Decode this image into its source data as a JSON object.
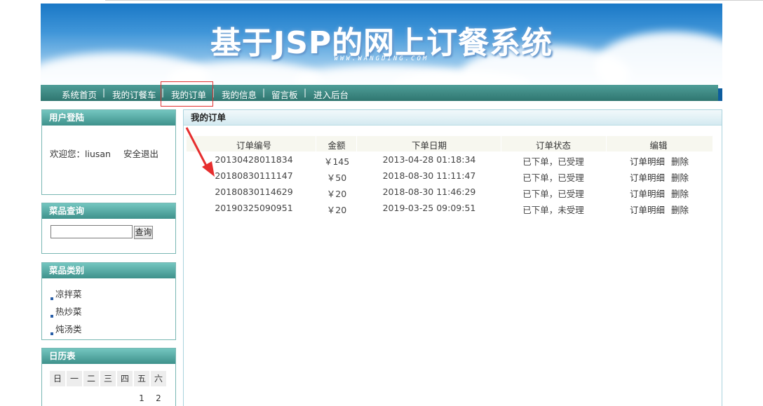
{
  "banner": {
    "title": "基于JSP的网上订餐系统",
    "subtitle": "WWW.WANGDING.COM"
  },
  "nav": {
    "items": [
      "系统首页",
      "我的订餐车",
      "我的订单",
      "我的信息",
      "留言板",
      "进入后台"
    ],
    "separator": "|",
    "active_index": 2
  },
  "login": {
    "title": "用户登陆",
    "welcome": "欢迎您：liusan",
    "logout": "安全退出"
  },
  "search": {
    "title": "菜品查询",
    "value": "",
    "button": "查询"
  },
  "categories": {
    "title": "菜品类别",
    "items": [
      "凉拌菜",
      "热炒菜",
      "炖汤类"
    ]
  },
  "calendar": {
    "title": "日历表",
    "weekdays": [
      "日",
      "一",
      "二",
      "三",
      "四",
      "五",
      "六"
    ],
    "first_row": [
      "",
      "",
      "",
      "",
      "",
      "1",
      "2"
    ]
  },
  "orders": {
    "title": "我的订单",
    "columns": [
      "订单编号",
      "金额",
      "下单日期",
      "订单状态",
      "编辑"
    ],
    "rows": [
      {
        "id": "20130428011834",
        "amount": "￥145",
        "date": "2013-04-28 01:18:34",
        "status": "已下单，已受理",
        "detail": "订单明细",
        "delete": "删除"
      },
      {
        "id": "20180830111147",
        "amount": "￥50",
        "date": "2018-08-30 11:11:47",
        "status": "已下单，已受理",
        "detail": "订单明细",
        "delete": "删除"
      },
      {
        "id": "20180830114629",
        "amount": "￥20",
        "date": "2018-08-30 11:46:29",
        "status": "已下单，已受理",
        "detail": "订单明细",
        "delete": "删除"
      },
      {
        "id": "20190325090951",
        "amount": "￥20",
        "date": "2019-03-25 09:09:51",
        "status": "已下单，未受理",
        "detail": "订单明细",
        "delete": "删除"
      }
    ]
  },
  "colors": {
    "nav_bg": "#2f7670",
    "sidebar_title": "#3e918b",
    "highlight_box": "#e03030",
    "arrow": "#e62e2e"
  }
}
